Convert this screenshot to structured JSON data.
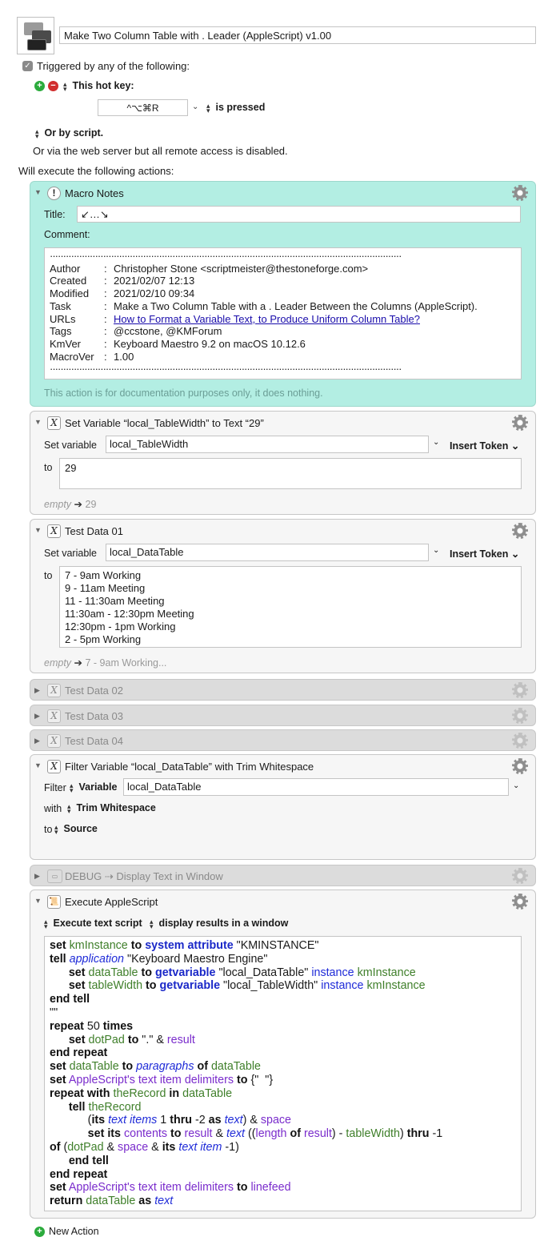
{
  "macro": {
    "name": "Make Two Column Table with . Leader (AppleScript) v1.00",
    "trigger_checkbox_label": "Triggered by any of the following:",
    "hotkey_label": "This hot key:",
    "hotkey_value": "^⌥⌘R",
    "hotkey_state": "is pressed",
    "by_script_label": "Or by script.",
    "web_server_text": "Or via the web server but all remote access is disabled.",
    "will_execute": "Will execute the following actions:",
    "new_action": "New Action"
  },
  "notes_action": {
    "title": "Macro Notes",
    "title_label": "Title:",
    "title_value": "↙…↘",
    "comment_label": "Comment:",
    "dots": "·······································································································································",
    "rows": [
      {
        "key": "Author",
        "value": "Christopher Stone <scriptmeister@thestoneforge.com>"
      },
      {
        "key": "Created",
        "value": "2021/02/07 12:13"
      },
      {
        "key": "Modified",
        "value": "2021/02/10 09:34"
      },
      {
        "key": "Task",
        "value": "Make a Two Column Table with a . Leader Between the Columns (AppleScript)."
      },
      {
        "key": "URLs",
        "value": "How to Format a Variable Text, to Produce Uniform Column Table?"
      },
      {
        "key": "Tags",
        "value": "@ccstone, @KMForum"
      },
      {
        "key": "KmVer",
        "value": "Keyboard Maestro 9.2 on macOS 10.12.6"
      },
      {
        "key": "MacroVer",
        "value": "1.00"
      }
    ],
    "colon": ":",
    "footer": "This action is for documentation purposes only, it does nothing."
  },
  "setvar1": {
    "title": "Set Variable “local_TableWidth” to Text “29”",
    "set_variable_label": "Set variable",
    "variable": "local_TableWidth",
    "insert_token": "Insert Token",
    "to_label": "to",
    "value": "29",
    "preview_empty": "empty",
    "preview_value": "29"
  },
  "testdata1": {
    "title": "Test Data 01",
    "set_variable_label": "Set variable",
    "variable": "local_DataTable",
    "insert_token": "Insert Token",
    "to_label": "to",
    "lines": [
      "7 - 9am Working",
      "9 - 11am Meeting",
      "11 - 11:30am Meeting",
      "11:30am - 12:30pm Meeting",
      "12:30pm - 1pm Working",
      "2 - 5pm Working"
    ],
    "preview_empty": "empty",
    "preview_value": "7 - 9am Working..."
  },
  "collapsed": [
    "Test Data 02",
    "Test Data 03",
    "Test Data 04"
  ],
  "filter_action": {
    "title": "Filter Variable “local_DataTable” with Trim Whitespace",
    "filter_label": "Filter",
    "variable_label": "Variable",
    "variable": "local_DataTable",
    "with_label": "with",
    "with_value": "Trim Whitespace",
    "to_label": "to",
    "to_value": "Source"
  },
  "debug_action": {
    "title": "DEBUG ⇢ Display Text in Window"
  },
  "applescript_action": {
    "title": "Execute AppleScript",
    "mode": "Execute text script",
    "results": "display results in a window"
  },
  "colors": {
    "notes_bg": "#b3eee3",
    "keyword": "#111111",
    "variable": "#3f7f2a",
    "property": "#7a2ccc",
    "class": "#1f2bd8"
  }
}
